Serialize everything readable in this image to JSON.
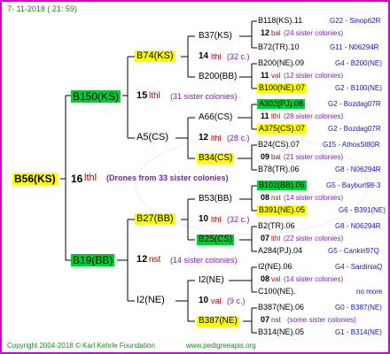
{
  "header": {
    "date": "7- 11-2018 ( 21: 59)"
  },
  "footer": {
    "copyright": "Copyright 2004-2018 © Karl Kehrle Foundation",
    "url": "www.pedigreeapis.org"
  },
  "tree": {
    "root": {
      "id": "B56(KS)",
      "year": "16",
      "type": "lthl",
      "drones": "(Drones from 33 sister colonies)"
    },
    "g2": [
      {
        "id": "B150(KS)",
        "year": "15",
        "type": "lthl",
        "sisters": "(31 sister colonies)"
      },
      {
        "id": "B19(BB)",
        "year": "12",
        "type": "nst",
        "sisters": "(14 sister colonies)"
      }
    ],
    "g3": [
      {
        "id": "B74(KS)",
        "year": "14",
        "type": "lthl",
        "sisters": "(32 c.)"
      },
      {
        "id": "A5(CS)",
        "year": "12",
        "type": "lthl",
        "sisters": "(28 c.)"
      },
      {
        "id": "B27(BB)",
        "year": "10",
        "type": "lthl",
        "sisters": "(32 c.)"
      },
      {
        "id": "I2(NE)",
        "year": "10",
        "type": "val",
        "sisters": "(9 c.)"
      }
    ],
    "g4": [
      {
        "id": "B37(KS)"
      },
      {
        "id": "B200(BB)"
      },
      {
        "id": "A66(CS)"
      },
      {
        "id": "B34(CS)"
      },
      {
        "id": "B53(BB)"
      },
      {
        "id": "B25(CS)"
      },
      {
        "id": "I2(NE)"
      },
      {
        "id": "B387(NE)"
      }
    ],
    "g5": [
      {
        "id": "B118(KS).11",
        "place": "G22 - Sinop62R",
        "year": "12",
        "type": "bal",
        "sisters": "(24 sister colonies)"
      },
      {
        "id": "B72(TR).10",
        "place": "G11 - N06294R"
      },
      {
        "id": "B200(NE).09",
        "place": "G4 - B200(NE)",
        "year": "11",
        "type": "val",
        "sisters": "(12 sister colonies)"
      },
      {
        "id": "B100(NE).07",
        "place": "G2 - B100(NE)"
      },
      {
        "id": "A302(PJ).08",
        "place": "G2 - Bozdag07R",
        "year": "11",
        "type": "lthl",
        "sisters": "(28 sister colonies)"
      },
      {
        "id": "A375(CS).07",
        "place": "G2 - Bozdag07R"
      },
      {
        "id": "B24(CS).07",
        "place": "G15 - AthosSt80R",
        "year": "09",
        "type": "bal",
        "sisters": "(21 sister colonies)"
      },
      {
        "id": "B78(TR).06",
        "place": "G8 - N06294R"
      },
      {
        "id": "B102(BB).06",
        "place": "G5 - Bayburt98-3",
        "year": "08",
        "type": "nst",
        "sisters": "(14 sister colonies)"
      },
      {
        "id": "B391(NE).05",
        "place": "G6 - B391(NE)"
      },
      {
        "id": "B2(TR).06",
        "place": "G8 - N06294R",
        "year": "07",
        "type": "lthl",
        "sisters": "(22 sister colonies)"
      },
      {
        "id": "A284(PJ).04",
        "place": "G5 - Cankiri97Q"
      },
      {
        "id": "I2(NE).06",
        "place": "G4 - SardiniaQ",
        "year": "08",
        "type": "val",
        "sisters": "(14 sister colonies)"
      },
      {
        "id": "C100(NE).",
        "place": "no more"
      },
      {
        "id": "B387(NE).06",
        "place": "G0 - B387(NE)",
        "year": "07",
        "type": "nst",
        "sisters": "(some sister colonies)"
      },
      {
        "id": "B314(NE).05",
        "place": "G1 - B314(NE)"
      }
    ]
  }
}
